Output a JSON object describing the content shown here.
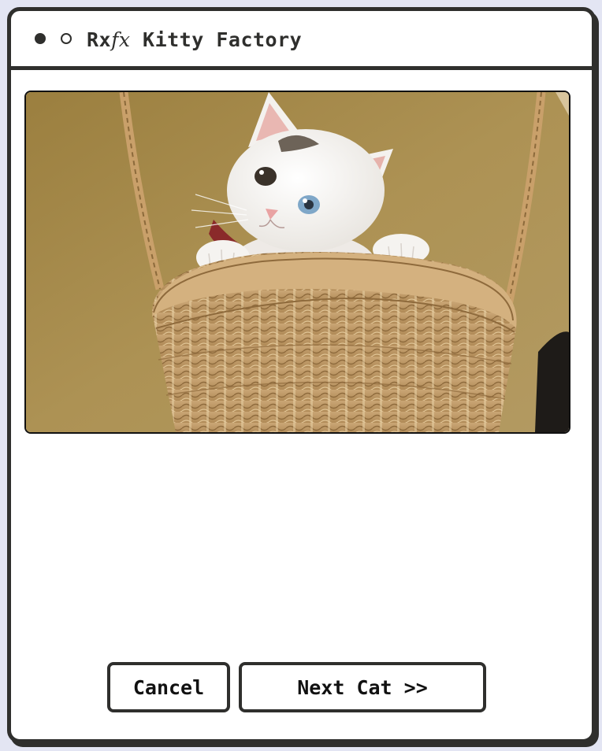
{
  "window": {
    "title_prefix": "Rx",
    "title_fx": "fx",
    "title_main": "Kitty Factory",
    "controls": [
      "close-dot",
      "minimize-dot"
    ]
  },
  "image": {
    "subject": "kitten-in-wicker-basket"
  },
  "buttons": {
    "cancel_label": "Cancel",
    "next_label": "Next Cat >>"
  },
  "colors": {
    "frame": "#2f2f2d",
    "background": "#e3e5f3",
    "photo_wall": "#a58a4a",
    "basket": "#c9a573"
  }
}
